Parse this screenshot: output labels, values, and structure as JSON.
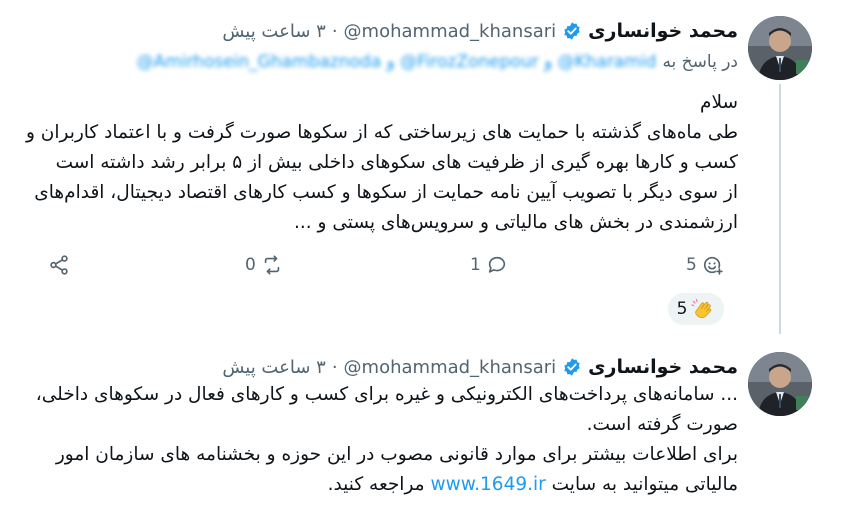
{
  "tweet1": {
    "author": {
      "display_name": "محمد خوانساری",
      "handle": "@mohammad_khansari",
      "verified": true
    },
    "time": "۳ ساعت پیش",
    "reply_to": {
      "prefix": "در پاسخ به",
      "mentions": "@Amirhosein_Ghambaznoda و @FirozZonepour و @Kharamid"
    },
    "lines": [
      "سلام",
      "طی ماه‌های گذشته با حمایت های زیرساختی که از سکوها صورت گرفت و با اعتماد کاربران و",
      "کسب و کارها بهره گیری از ظرفیت های سکوهای داخلی بیش از ۵ برابر رشد داشته است",
      "از سوی دیگر با تصویب آیین نامه حمایت از سکوها و کسب کارهای اقتصاد دیجیتال، اقدام‌های",
      "ارزشمندی در بخش های مالیاتی و سرویس‌های پستی و ..."
    ],
    "actions": {
      "react_count": "5",
      "reply_count": "1",
      "repost_count": "0"
    },
    "reaction": {
      "emoji_icon": "clapping-hands-icon",
      "count": "5"
    }
  },
  "tweet2": {
    "author": {
      "display_name": "محمد خوانساری",
      "handle": "@mohammad_khansari",
      "verified": true
    },
    "time": "۳ ساعت پیش",
    "lines": [
      "... سامانه‌های پرداخت‌های الکترونیکی و غیره برای کسب و کارهای فعال در سکوهای داخلی،",
      "صورت گرفته است.",
      "برای اطلاعات بیشتر برای موارد قانونی مصوب در این حوزه و بخشنامه های سازمان امور"
    ],
    "last_line_prefix": "مالیاتی میتوانید به سایت",
    "link": "www.1649.ir",
    "last_line_suffix": "مراجعه کنید."
  },
  "colors": {
    "text": "#0f1419",
    "secondary": "#536471",
    "link": "#1d9bf0",
    "verified": "#1d9bf0",
    "thread_line": "#cfd9de",
    "reaction_bg": "#eef3f4"
  }
}
